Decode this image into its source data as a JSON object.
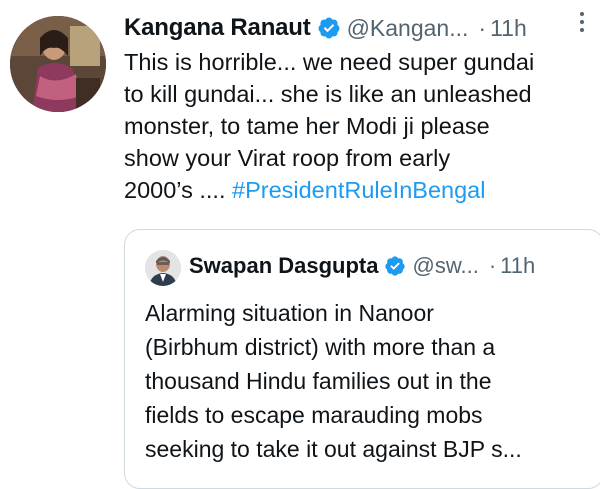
{
  "tweet": {
    "display_name": "Kangana Ranaut",
    "handle": "@Kangan...",
    "separator": "·",
    "time": "11h",
    "text_lines": [
      "This is horrible... we need super gundai",
      "to kill gundai... she is like an unleashed",
      "monster, to tame her Modi ji please",
      "show your Virat roop from early"
    ],
    "last_line_prefix": "2000’s .... ",
    "hashtag": "#PresidentRuleInBengal",
    "icons": {
      "avatar": "avatar",
      "verified": "verified-badge-icon",
      "more": "more-options-icon"
    }
  },
  "quoted_tweet": {
    "display_name": "Swapan Dasgupta",
    "handle": "@sw...",
    "separator": "·",
    "time": "11h",
    "text_lines": [
      "Alarming situation in Nanoor",
      "(Birbhum district) with more than a",
      "thousand Hindu families out in the",
      "fields to escape marauding mobs",
      "seeking to take it out against BJP s..."
    ],
    "icons": {
      "avatar": "avatar",
      "verified": "verified-badge-icon"
    }
  },
  "colors": {
    "text": "#0f1419",
    "secondary": "#536471",
    "link": "#1d9bf0",
    "border": "#cfd9de",
    "verified": "#1d9bf0"
  }
}
